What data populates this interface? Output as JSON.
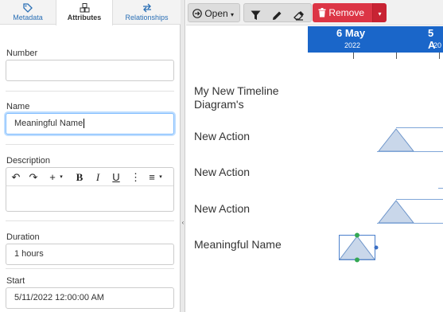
{
  "tabs": [
    {
      "label": "Metadata",
      "icon": "tags-icon"
    },
    {
      "label": "Attributes",
      "icon": "cubes-icon",
      "active": true
    },
    {
      "label": "Relationships",
      "icon": "swap-arrows-icon"
    }
  ],
  "form": {
    "number_label": "Number",
    "number_value": "",
    "name_label": "Name",
    "name_value": "Meaningful Name",
    "description_label": "Description",
    "description_value": "",
    "duration_label": "Duration",
    "duration_value": "1 hours",
    "start_label": "Start",
    "start_value": "5/11/2022 12:00:00 AM"
  },
  "editor_toolbar": {
    "undo": "↶",
    "redo": "↷",
    "insert": "+",
    "bold": "B",
    "italic": "I",
    "underline": "U",
    "more": "⋮",
    "align": "≡"
  },
  "toolbar": {
    "open_label": "Open",
    "remove_label": "Remove"
  },
  "timeline": {
    "dates": [
      {
        "day": "6 May",
        "year": "2022"
      },
      {
        "day": "5 A",
        "year": "20"
      }
    ],
    "rows": [
      {
        "label": "My New Timeline Diagram's"
      },
      {
        "label": "New Action"
      },
      {
        "label": "New Action"
      },
      {
        "label": "New Action"
      },
      {
        "label": "Meaningful Name",
        "selected": true
      }
    ]
  },
  "colors": {
    "accent": "#1a66c9",
    "remove": "#dc3545",
    "milestone_fill": "#c9d7ea",
    "milestone_stroke": "#6b93c9",
    "handle": "#34a853"
  }
}
